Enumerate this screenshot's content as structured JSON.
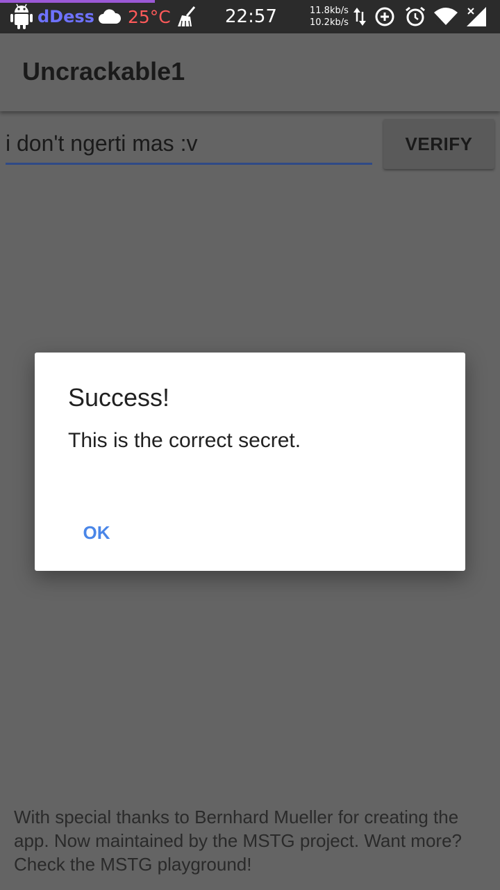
{
  "status_bar": {
    "carrier": "dDess",
    "temperature": "25°C",
    "time": "22:57",
    "upload_speed": "11.8kb/s",
    "download_speed": "10.2kb/s",
    "progress_fraction": 0.31,
    "icons": [
      "android-icon",
      "cloud-icon",
      "broom-icon",
      "data-arrows-icon",
      "data-saver-icon",
      "alarm-icon",
      "wifi-icon",
      "signal-icon"
    ],
    "colors": {
      "carrier": "#6e72ff",
      "temperature": "#ff5a5a",
      "progress": "#9b59d6"
    }
  },
  "app_bar": {
    "title": "Uncrackable1"
  },
  "secret_input": {
    "value": "i don't ngerti mas :v"
  },
  "verify_button": {
    "label": "VERIFY"
  },
  "dialog": {
    "title": "Success!",
    "message": "This is the correct secret.",
    "ok_label": "OK"
  },
  "footer": {
    "text": "With special thanks to Bernhard Mueller for creating the app. Now maintained by the MSTG project. Want more? Check the MSTG playground!"
  },
  "colors": {
    "accent": "#4a86e8",
    "input_underline": "#2f4a86",
    "scrim_background": "#646464"
  }
}
